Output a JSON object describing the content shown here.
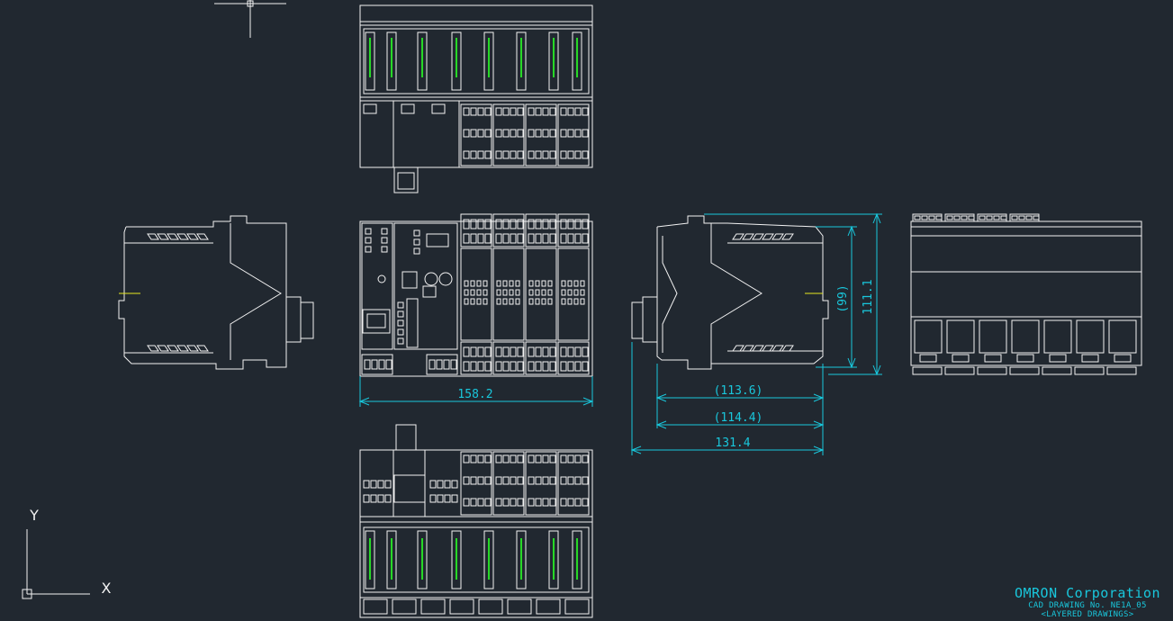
{
  "drawing": {
    "dimensions": [
      {
        "id": "width",
        "text": "158.2"
      },
      {
        "id": "depth-1",
        "text": "(113.6)"
      },
      {
        "id": "depth-2",
        "text": "(114.4)"
      },
      {
        "id": "depth-3",
        "text": "131.4"
      },
      {
        "id": "height-inner",
        "text": "(99)"
      },
      {
        "id": "height",
        "text": "111.1"
      }
    ],
    "axes": {
      "y_label": "Y",
      "x_label": "X"
    },
    "title_block": {
      "company": "OMRON Corporation",
      "drawing_no": "CAD DRAWING No. NE1A_05",
      "note": "<LAYERED DRAWINGS>"
    },
    "colors": {
      "background": "#212830",
      "outline": "#f2f2f2",
      "dimension": "#19c7dc",
      "indicator": "#27d827",
      "centerline": "#e8e820"
    }
  }
}
